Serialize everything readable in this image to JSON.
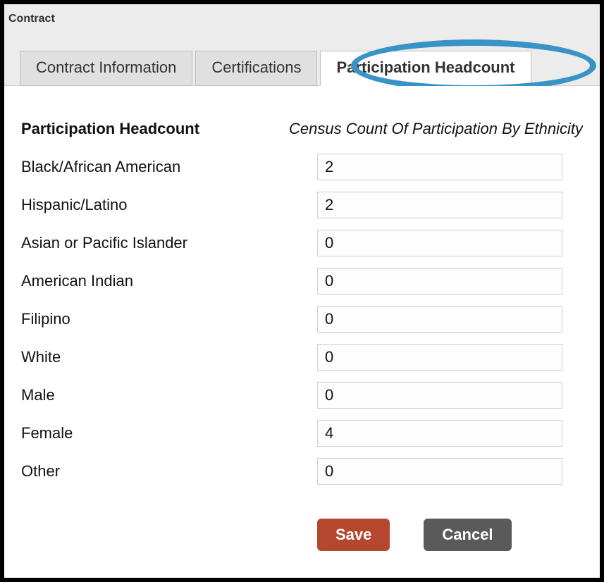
{
  "breadcrumb": "Contract",
  "tabs": {
    "0": {
      "label": "Contract Information"
    },
    "1": {
      "label": "Certifications"
    },
    "2": {
      "label": "Participation Headcount"
    }
  },
  "section": {
    "title": "Participation Headcount",
    "column_header": "Census Count Of Participation By Ethnicity"
  },
  "fields": {
    "black_african_american": {
      "label": "Black/African American",
      "value": "2"
    },
    "hispanic_latino": {
      "label": "Hispanic/Latino",
      "value": "2"
    },
    "asian_pacific": {
      "label": "Asian or Pacific Islander",
      "value": "0"
    },
    "american_indian": {
      "label": "American Indian",
      "value": "0"
    },
    "filipino": {
      "label": "Filipino",
      "value": "0"
    },
    "white": {
      "label": "White",
      "value": "0"
    },
    "male": {
      "label": "Male",
      "value": "0"
    },
    "female": {
      "label": "Female",
      "value": "4"
    },
    "other": {
      "label": "Other",
      "value": "0"
    }
  },
  "buttons": {
    "save": "Save",
    "cancel": "Cancel"
  }
}
